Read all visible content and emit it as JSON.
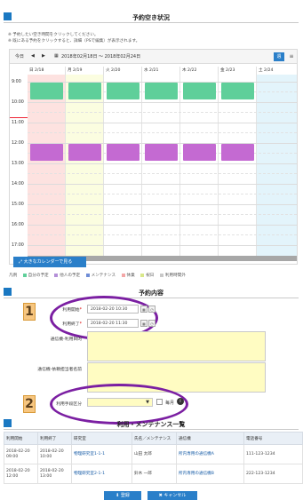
{
  "availability": {
    "title": "予約空き状況",
    "notes": [
      "※ 予約したい空き時間をクリックしてください。",
      "※ 既にある予約をクリックすると、詳細（PSで編集）が表示されます。"
    ],
    "toolbar": {
      "today_label": "今日",
      "prev_icon": "◀",
      "next_icon": "▶",
      "date_range": "2018年02月18日 ～ 2018年02月24日",
      "week_label": "週",
      "menu_icon": "≡"
    },
    "day_headers": [
      "日 2/18",
      "月 2/19",
      "火 2/20",
      "水 2/21",
      "木 2/22",
      "金 2/23",
      "土 2/24"
    ],
    "times": [
      "9:00",
      "10:00",
      "11:00",
      "12:00",
      "13:00",
      "14:00",
      "15:00",
      "16:00",
      "17:00"
    ],
    "big_calendar_button": "大きなカレンダーで見る",
    "legend_prefix": "凡例",
    "legend": [
      {
        "label": "自分の予定",
        "color": "#5fcf9a"
      },
      {
        "label": "他人の予定",
        "color": "#b48fd8"
      },
      {
        "label": "メンテナンス",
        "color": "#6f8dd6"
      },
      {
        "label": "休業",
        "color": "#f4a7a7"
      },
      {
        "label": "祝日",
        "color": "#d9e88a"
      },
      {
        "label": "利用時間外",
        "color": "#c8c8c8"
      }
    ],
    "colors": {
      "own": "#5fcf9a",
      "others": "#c46ad2",
      "holiday_col": "#fde2e0",
      "today_col": "#fbfde0",
      "sat_col": "#e3f4fb",
      "now_line": "#e22233"
    }
  },
  "reservation": {
    "title": "予約内容",
    "start_label": "利用開始",
    "end_label": "利用終了",
    "start_value": "2018-02-20 10:30",
    "end_value": "2018-02-20 11:30",
    "purpose_label": "通信機-利用目的",
    "requester_label": "通信機-依頼担当者名前",
    "category_label": "利用手段区分",
    "category_value": "▼",
    "recurring_label": "毎月",
    "badges": [
      "1",
      "2"
    ]
  },
  "maintenance": {
    "title": "利用・メンテナンス一覧",
    "headers": [
      "利用開始",
      "利用終了",
      "研究室",
      "氏名／メンテナンス",
      "通信機",
      "電話番号"
    ],
    "rows": [
      [
        "2018-02-20 09:00",
        "2018-02-20 10:00",
        "物理研究室1-1-1",
        "山田 太郎",
        "所内専用の通信機A",
        "111-123-1234"
      ],
      [
        "2018-02-20 12:00",
        "2018-02-20 13:00",
        "物理研究室2-1-1",
        "鈴木 一郎",
        "所内専用の通信機B",
        "222-123-1234"
      ]
    ]
  },
  "actions": {
    "register_label": "⬇ 登録",
    "cancel_label": "✖ キャンセル"
  }
}
